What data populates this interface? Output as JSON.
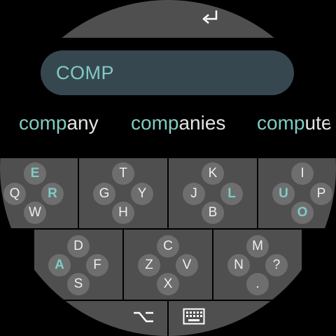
{
  "enter_key": {
    "icon": "enter-return-icon"
  },
  "input": {
    "value": "COMP"
  },
  "suggestions": [
    {
      "prefix": "comp",
      "rest": "any"
    },
    {
      "prefix": "comp",
      "rest": "anies"
    },
    {
      "prefix": "comp",
      "rest": "ute."
    }
  ],
  "keys": {
    "k1": {
      "top": "E",
      "left": "Q",
      "right": "R",
      "bottom": "W"
    },
    "k2": {
      "top": "T",
      "left": "G",
      "right": "Y",
      "bottom": "H"
    },
    "k3": {
      "top": "K",
      "left": "J",
      "right": "L",
      "bottom": "B"
    },
    "k4": {
      "top": "I",
      "left": "U",
      "right": "P",
      "bottom": "O"
    },
    "k5": {
      "top": "D",
      "left": "A",
      "right": "F",
      "bottom": "S"
    },
    "k6": {
      "top": "C",
      "left": "Z",
      "right": "V",
      "bottom": "X"
    },
    "k7": {
      "top": "M",
      "left": "N",
      "right": "?",
      "bottom": "."
    }
  },
  "bottom_bar": {
    "left_icon": "alt-option-icon",
    "right_icon": "keyboard-icon"
  },
  "colors": {
    "accent": "#80cbc4",
    "key_bg": "#4f4f4f",
    "circle_bg": "#6e6e6e",
    "input_bg": "#37474f"
  }
}
